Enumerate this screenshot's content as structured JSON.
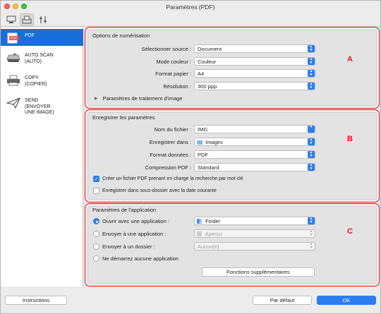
{
  "window": {
    "title": "Paramètres (PDF)"
  },
  "toolbar": {
    "items": [
      "scan-to-computer-icon",
      "scan-to-document-icon",
      "tools-icon"
    ]
  },
  "sidebar": {
    "items": [
      {
        "label": "PDF",
        "icon": "pdf-icon",
        "selected": true
      },
      {
        "label": "AUTO SCAN\n(AUTO)",
        "icon": "scanner-icon",
        "selected": false
      },
      {
        "label": "COPY\n(COPIER)",
        "icon": "printer-icon",
        "selected": false
      },
      {
        "label": "SEND\n(ENVOYER\nUNE IMAGE)",
        "icon": "send-icon",
        "selected": false
      }
    ]
  },
  "scan_options": {
    "title": "Options de numérisation",
    "source_label": "Sélectionner source :",
    "source_value": "Document",
    "color_label": "Mode couleur :",
    "color_value": "Couleur",
    "paper_label": "Format papier :",
    "paper_value": "A4",
    "resolution_label": "Résolution :",
    "resolution_value": "300 ppp",
    "image_processing_label": "Paramètres de traitement d'image",
    "marker": "A"
  },
  "save_settings": {
    "title": "Enregistrer les paramètres",
    "filename_label": "Nom du fichier :",
    "filename_value": "IMG",
    "save_in_label": "Enregistrer dans :",
    "save_in_value": "Images",
    "format_label": "Format données :",
    "format_value": "PDF",
    "compression_label": "Compression PDF :",
    "compression_value": "Standard",
    "keyword_search_label": "Créer un fichier PDF prenant en charge la recherche par mot clé",
    "keyword_search_checked": true,
    "subfolder_label": "Enregistrer dans sous-dossier avec la date courante",
    "subfolder_checked": false,
    "marker": "B"
  },
  "app_settings": {
    "title": "Paramètres de l'application",
    "open_app_label": "Ouvrir avec une application :",
    "open_app_value": "Finder",
    "send_app_label": "Envoyer à une application :",
    "send_app_value": "Aperçu",
    "send_folder_label": "Envoyer à un dossier :",
    "send_folder_value": "Aucun(e)",
    "no_launch_label": "Ne démarrez aucune application",
    "more_functions_label": "Fonctions supplémentaires",
    "marker": "C"
  },
  "footer": {
    "instructions_label": "Instructions",
    "default_label": "Par défaut",
    "ok_label": "OK"
  }
}
